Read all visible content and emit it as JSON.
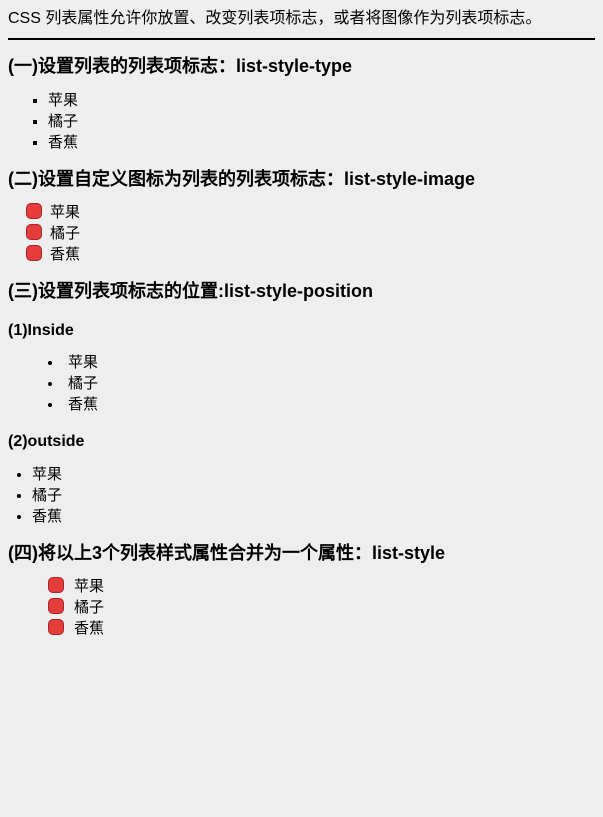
{
  "intro": "CSS 列表属性允许你放置、改变列表项标志，或者将图像作为列表项标志。",
  "sections": {
    "one": {
      "heading": "(一)设置列表的列表项标志：list-style-type",
      "items": [
        "苹果",
        "橘子",
        "香蕉"
      ]
    },
    "two": {
      "heading": "(二)设置自定义图标为列表的列表项标志：list-style-image",
      "items": [
        "苹果",
        "橘子",
        "香蕉"
      ]
    },
    "three": {
      "heading": "(三)设置列表项标志的位置:list-style-position",
      "sub1": {
        "heading": "(1)Inside",
        "items": [
          "苹果",
          "橘子",
          "香蕉"
        ]
      },
      "sub2": {
        "heading": "(2)outside",
        "items": [
          "苹果",
          "橘子",
          "香蕉"
        ]
      }
    },
    "four": {
      "heading": "(四)将以上3个列表样式属性合并为一个属性：list-style",
      "items": [
        "苹果",
        "橘子",
        "香蕉"
      ]
    }
  }
}
